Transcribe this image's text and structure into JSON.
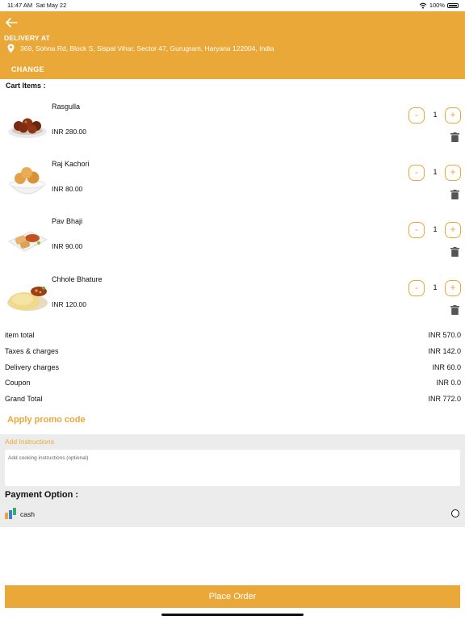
{
  "status_bar": {
    "time": "11:47 AM",
    "date": "Sat May 22",
    "battery": "100%",
    "icons": [
      "wifi-icon",
      "battery-icon"
    ]
  },
  "header": {
    "back_icon": "back-arrow-icon",
    "delivery_label": "DELIVERY AT",
    "location_icon": "location-pin-icon",
    "address": "369, Sohna Rd, Block S, Sispal Vihar, Sector 47, Gurugram, Haryana 122004, India",
    "change_label": "CHANGE"
  },
  "cart": {
    "title": "Cart Items :",
    "items": [
      {
        "name": "Rasgulla",
        "price": "INR 280.00",
        "quantity": "1",
        "minus": "-",
        "plus": "+"
      },
      {
        "name": "Raj Kachori",
        "price": "INR 80.00",
        "quantity": "1",
        "minus": "-",
        "plus": "+"
      },
      {
        "name": "Pav Bhaji",
        "price": "INR 90.00",
        "quantity": "1",
        "minus": "-",
        "plus": "+"
      },
      {
        "name": "Chhole Bhature",
        "price": "INR 120.00",
        "quantity": "1",
        "minus": "-",
        "plus": "+"
      }
    ]
  },
  "summary": {
    "item_total_label": "item total",
    "item_total_value": "INR 570.0",
    "taxes_label": "Taxes & charges",
    "taxes_value": "INR 142.0",
    "delivery_label": "Delivery charges",
    "delivery_value": "INR 60.0",
    "coupon_label": "Coupon",
    "coupon_value": "INR 0.0",
    "grand_total_label": "Grand Total",
    "grand_total_value": "INR 772.0"
  },
  "promo": {
    "label": "Apply promo code"
  },
  "instructions": {
    "title": "Add Instructions",
    "placeholder": "Add cooking instructions (optional)",
    "value": ""
  },
  "payment": {
    "title": "Payment Option :",
    "options": [
      {
        "label": "cash",
        "selected": false
      }
    ]
  },
  "footer": {
    "place_order_label": "Place Order"
  },
  "colors": {
    "accent": "#e9a838",
    "section_bg": "#ececec"
  }
}
